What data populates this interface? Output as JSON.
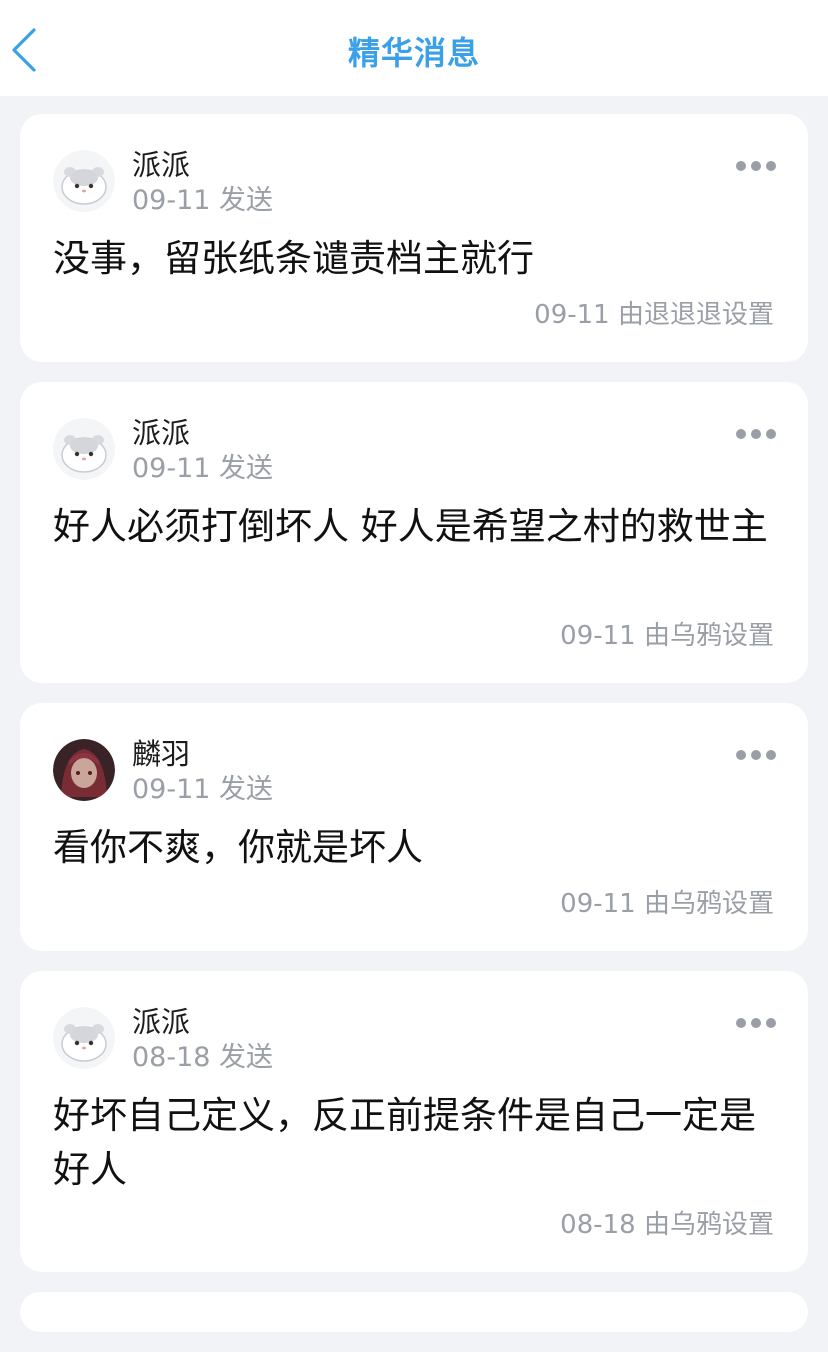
{
  "header": {
    "title": "精华消息",
    "back_icon": "chevron-left-icon"
  },
  "colors": {
    "accent": "#3aa0e8",
    "meta": "#9a9ea6",
    "background": "#f2f3f7"
  },
  "posts": [
    {
      "user": "派派",
      "sent": "09-11 发送",
      "text": "没事，留张纸条谴责档主就行",
      "set_by": "09-11 由退退退设置",
      "avatar": "hamster-avatar"
    },
    {
      "user": "派派",
      "sent": "09-11 发送",
      "text": "好人必须打倒坏人 好人是希望之村的救世主",
      "set_by": "09-11 由乌鸦设置",
      "avatar": "hamster-avatar"
    },
    {
      "user": "麟羽",
      "sent": "09-11 发送",
      "text": "看你不爽，你就是坏人",
      "set_by": "09-11 由乌鸦设置",
      "avatar": "anime-girl-avatar"
    },
    {
      "user": "派派",
      "sent": "08-18 发送",
      "text": "好坏自己定义，反正前提条件是自己一定是好人",
      "set_by": "08-18 由乌鸦设置",
      "avatar": "hamster-avatar"
    }
  ]
}
